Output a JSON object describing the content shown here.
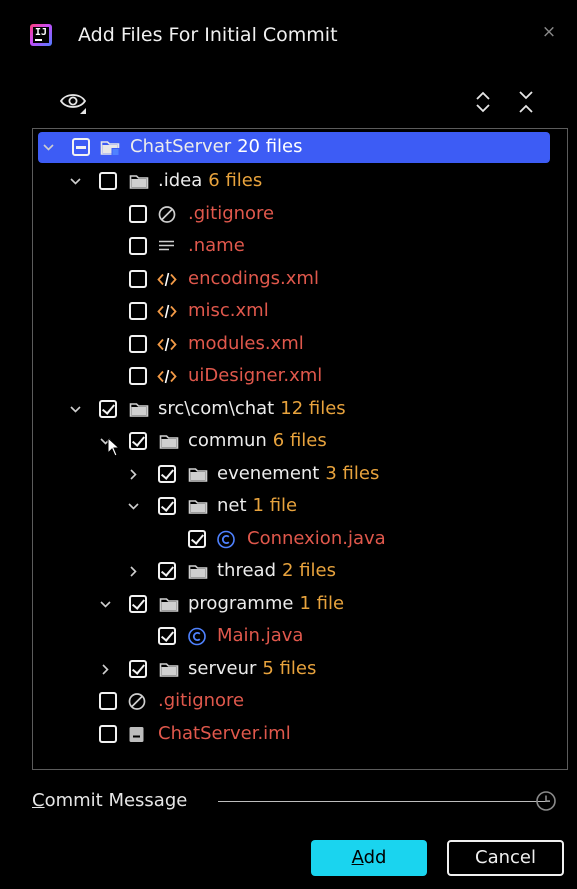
{
  "window": {
    "title": "Add Files For Initial Commit",
    "close_glyph": "×"
  },
  "toolbar": {
    "view_icon": "eye-icon",
    "expand_icon": "expand-all-icon",
    "collapse_icon": "collapse-all-icon"
  },
  "colors": {
    "selection": "#3d5cf5",
    "count": "#e8a33d",
    "unversioned": "#e0584c",
    "primary_button": "#1ad4ef",
    "java_icon": "#4f82ff"
  },
  "tree": {
    "root": {
      "name": "ChatServer",
      "count": "20 files",
      "state": "partial"
    },
    "idea": {
      "name": ".idea",
      "count": "6 files",
      "state": "unchecked"
    },
    "idea_files": [
      {
        "name": ".gitignore",
        "icon": "ignore-icon"
      },
      {
        "name": ".name",
        "icon": "text-file-icon"
      },
      {
        "name": "encodings.xml",
        "icon": "xml-icon"
      },
      {
        "name": "misc.xml",
        "icon": "xml-icon"
      },
      {
        "name": "modules.xml",
        "icon": "xml-icon"
      },
      {
        "name": "uiDesigner.xml",
        "icon": "xml-icon"
      }
    ],
    "src": {
      "name": "src\\com\\chat",
      "count": "12 files",
      "state": "checked"
    },
    "commun": {
      "name": "commun",
      "count": "6 files",
      "state": "checked"
    },
    "evenement": {
      "name": "evenement",
      "count": "3 files",
      "state": "checked"
    },
    "net": {
      "name": "net",
      "count": "1 file",
      "state": "checked"
    },
    "connexion": {
      "name": "Connexion.java",
      "state": "checked"
    },
    "thread": {
      "name": "thread",
      "count": "2 files",
      "state": "checked"
    },
    "programme": {
      "name": "programme",
      "count": "1 file",
      "state": "checked"
    },
    "main": {
      "name": "Main.java",
      "state": "checked"
    },
    "serveur": {
      "name": "serveur",
      "count": "5 files",
      "state": "checked"
    },
    "root_gitignore": {
      "name": ".gitignore",
      "state": "unchecked"
    },
    "iml": {
      "name": "ChatServer.iml",
      "state": "unchecked"
    }
  },
  "commit": {
    "label_mnemonic": "C",
    "label_rest": "ommit Message"
  },
  "buttons": {
    "add_mnemonic": "A",
    "add_rest": "dd",
    "cancel": "Cancel"
  }
}
